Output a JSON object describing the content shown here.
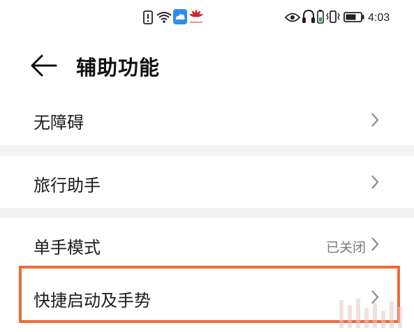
{
  "status_bar": {
    "time": "4:03",
    "left_icons": [
      "alert-sim-icon",
      "wifi-icon",
      "cloud-app-icon",
      "huawei-logo-icon"
    ],
    "right_icons": [
      "eye-comfort-icon",
      "headset-icon",
      "battery-saver-icon",
      "vibrate-icon",
      "battery-icon"
    ]
  },
  "header": {
    "title": "辅助功能",
    "back_icon": "arrow-left-icon"
  },
  "groups": [
    {
      "items": [
        {
          "label": "无障碍"
        }
      ]
    },
    {
      "items": [
        {
          "label": "旅行助手"
        }
      ]
    },
    {
      "items": [
        {
          "label": "单手模式",
          "status": "已关闭"
        },
        {
          "label": "快捷启动及手势"
        }
      ]
    }
  ],
  "colors": {
    "background": "#f4f4f4",
    "surface": "#ffffff",
    "highlight": "#ef6a3c",
    "secondary_text": "#7a7a7a"
  }
}
